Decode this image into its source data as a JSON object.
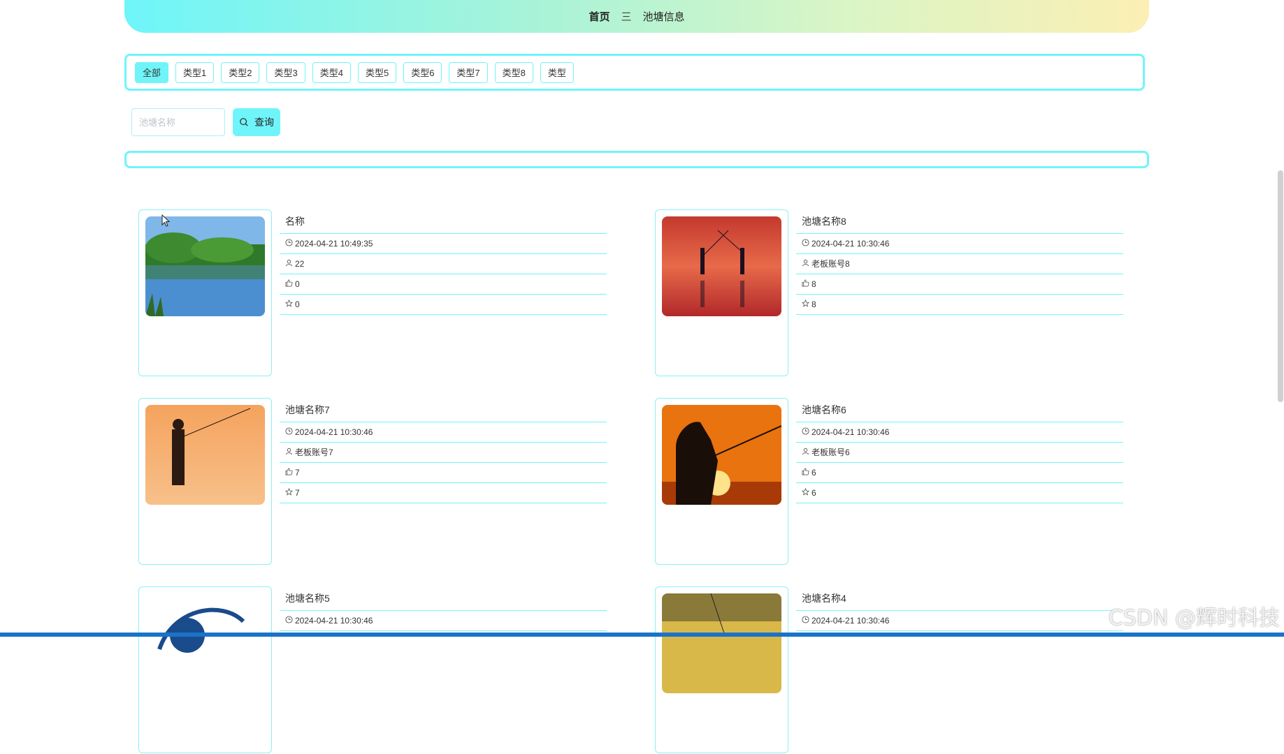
{
  "breadcrumb": {
    "home": "首页",
    "separator": "三",
    "current": "池塘信息"
  },
  "filters": [
    "全部",
    "类型1",
    "类型2",
    "类型3",
    "类型4",
    "类型5",
    "类型6",
    "类型7",
    "类型8",
    "类型"
  ],
  "active_filter": "全部",
  "search": {
    "placeholder": "池塘名称",
    "button": "查询"
  },
  "cards": [
    {
      "title": "名称",
      "time": "2024-04-21 10:49:35",
      "user": "22",
      "likes": "0",
      "favs": "0",
      "image": "lake-trees"
    },
    {
      "title": "池塘名称8",
      "time": "2024-04-21 10:30:46",
      "user": "老板账号8",
      "likes": "8",
      "favs": "8",
      "image": "sunset-two-fishermen"
    },
    {
      "title": "池塘名称7",
      "time": "2024-04-21 10:30:46",
      "user": "老板账号7",
      "likes": "7",
      "favs": "7",
      "image": "orange-fisherman"
    },
    {
      "title": "池塘名称6",
      "time": "2024-04-21 10:30:46",
      "user": "老板账号6",
      "likes": "6",
      "favs": "6",
      "image": "sunset-silhouette"
    },
    {
      "title": "池塘名称5",
      "time": "2024-04-21 10:30:46",
      "user": "",
      "likes": "",
      "favs": "",
      "image": "fish-logo"
    },
    {
      "title": "池塘名称4",
      "time": "2024-04-21 10:30:46",
      "user": "",
      "likes": "",
      "favs": "",
      "image": "golden-fisherman"
    }
  ],
  "watermark": "CSDN @辉时科技",
  "colors": {
    "accent": "#6ff5f9",
    "gradient_end": "#fbefb4"
  }
}
